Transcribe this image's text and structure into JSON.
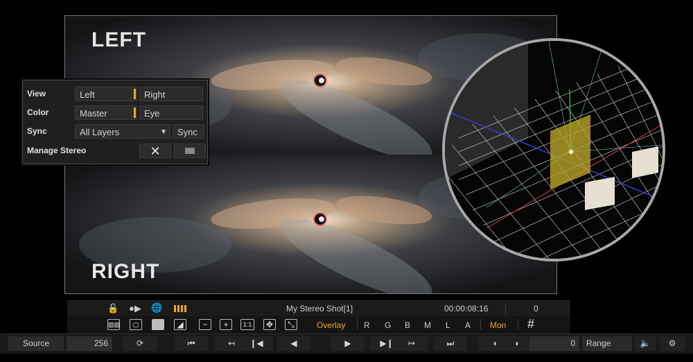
{
  "viewer": {
    "left_label": "LEFT",
    "right_label": "RIGHT"
  },
  "stereo_panel": {
    "view": {
      "label": "View",
      "left": "Left",
      "right": "Right"
    },
    "color": {
      "label": "Color",
      "master": "Master",
      "eye": "Eye"
    },
    "sync": {
      "label": "Sync",
      "layers": "All Layers",
      "button": "Sync"
    },
    "manage": {
      "label": "Manage Stereo",
      "close": "✕"
    }
  },
  "info_bar": {
    "shot_name": "My Stereo Shot[1]",
    "timecode": "00:00:08:16",
    "frame": "0"
  },
  "view_bar": {
    "one_to_one": "1:1",
    "overlay": "Overlay",
    "channels": [
      "R",
      "G",
      "B",
      "M",
      "L",
      "A"
    ],
    "mon": "Mon",
    "grid": "#"
  },
  "transport": {
    "source_label": "Source",
    "source_value": "256",
    "frame_value": "0",
    "range_label": "Range"
  },
  "colors": {
    "accent": "#f0a91b",
    "background": "#000000"
  }
}
